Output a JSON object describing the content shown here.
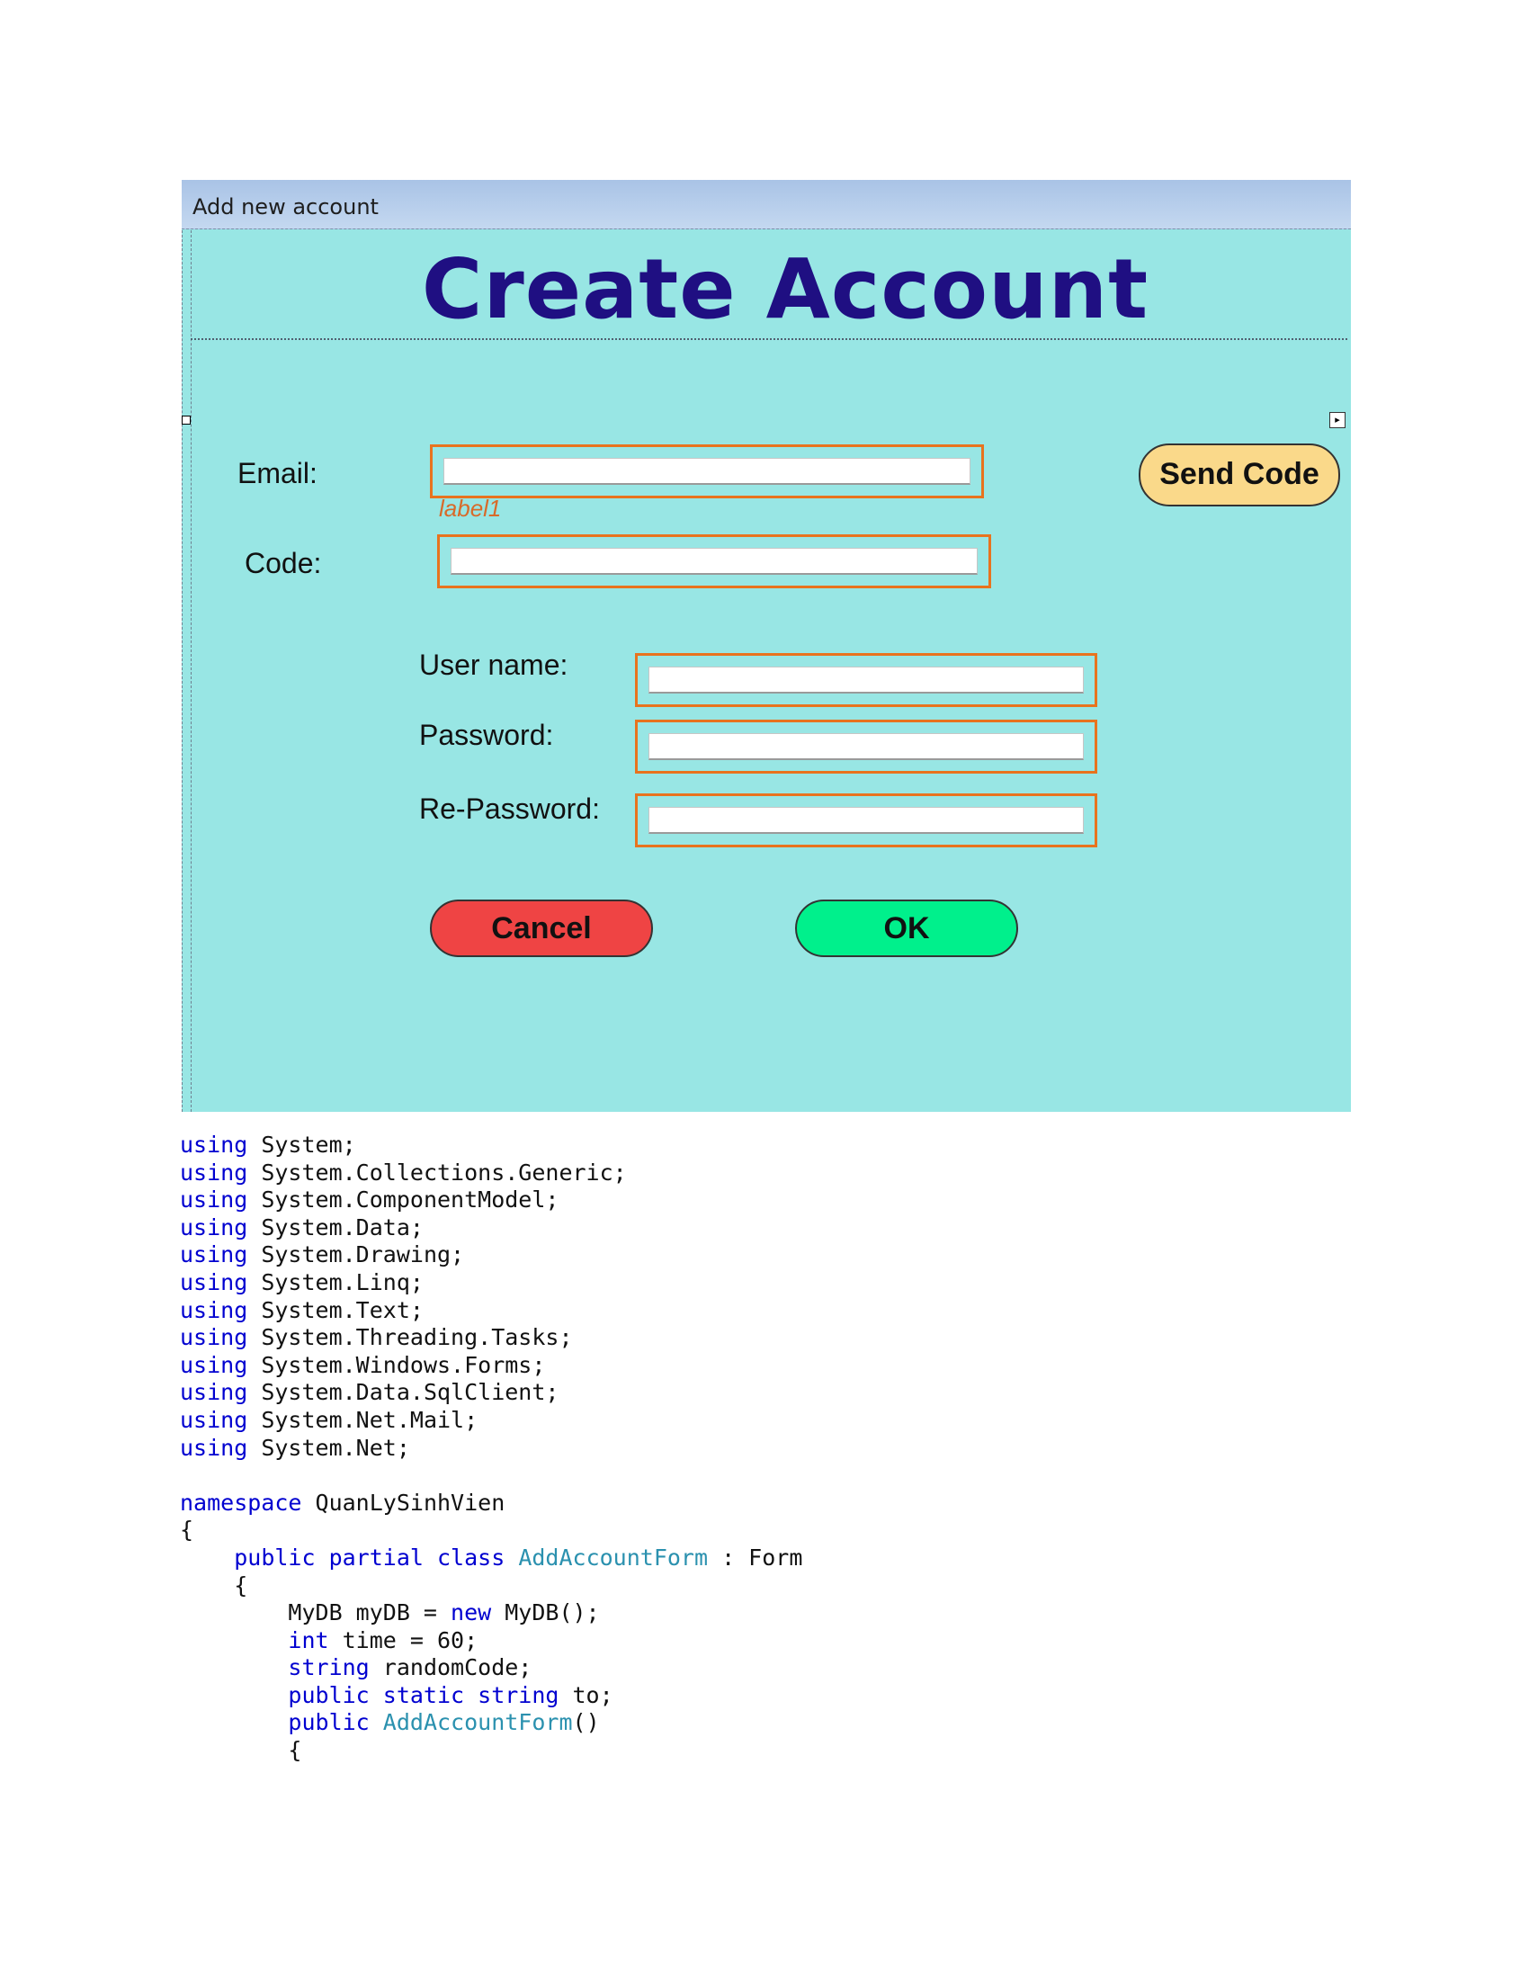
{
  "window": {
    "title": "Add new account",
    "heading": "Create Account"
  },
  "colors": {
    "form_background": "#98e6e4",
    "heading_color": "#1f0f82",
    "textbox_border": "#e8731e",
    "send_code_button": "#fad98a",
    "cancel_button": "#ef4444",
    "ok_button": "#00f08c",
    "keyword": "#0000d0",
    "type_name": "#2b91af"
  },
  "form": {
    "email_label": "Email:",
    "email_value": "",
    "send_code_label": "Send Code",
    "status_label": "label1",
    "code_label": "Code:",
    "code_value": "",
    "username_label": "User name:",
    "username_value": "",
    "password_label": "Password:",
    "password_value": "",
    "repassword_label": "Re-Password:",
    "repassword_value": "",
    "cancel_label": "Cancel",
    "ok_label": "OK"
  },
  "code": {
    "usings": [
      "System;",
      "System.Collections.Generic;",
      "System.ComponentModel;",
      "System.Data;",
      "System.Drawing;",
      "System.Linq;",
      "System.Text;",
      "System.Threading.Tasks;",
      "System.Windows.Forms;",
      "System.Data.SqlClient;",
      "System.Net.Mail;",
      "System.Net;"
    ],
    "using_keyword": "using",
    "namespace_keyword": "namespace",
    "namespace_name": "QuanLySinhVien",
    "open_brace": "{",
    "class_modifiers": "public partial class",
    "class_name": "AddAccountForm",
    "class_base": " : Form",
    "field_db_type": "MyDB myDB = ",
    "new_keyword": "new",
    "field_db_init": " MyDB();",
    "int_keyword": "int",
    "field_time": " time = 60;",
    "string_keyword": "string",
    "field_random": " randomCode;",
    "public_static_string": "public static string",
    "field_to": " to;",
    "public_keyword": "public",
    "ctor_name": "AddAccountForm",
    "ctor_parens": "()"
  }
}
